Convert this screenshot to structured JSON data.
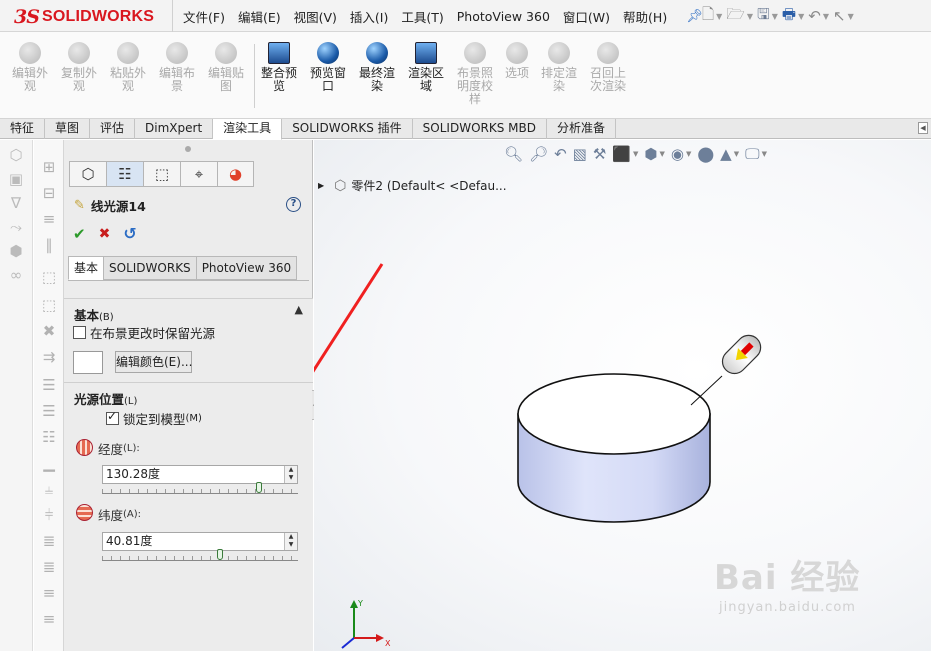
{
  "app": {
    "brand_ds": "3S",
    "brand_name": "SOLIDWORKS"
  },
  "menu": {
    "items": [
      "文件(F)",
      "编辑(E)",
      "视图(V)",
      "插入(I)",
      "工具(T)",
      "PhotoView 360",
      "窗口(W)",
      "帮助(H)"
    ]
  },
  "ribbon": {
    "buttons": [
      {
        "label1": "编辑外",
        "label2": "观"
      },
      {
        "label1": "复制外",
        "label2": "观"
      },
      {
        "label1": "粘贴外",
        "label2": "观"
      },
      {
        "label1": "编辑布",
        "label2": "景"
      },
      {
        "label1": "编辑贴",
        "label2": "图"
      },
      {
        "label1": "整合预",
        "label2": "览"
      },
      {
        "label1": "预览窗",
        "label2": "口"
      },
      {
        "label1": "最终渲",
        "label2": "染"
      },
      {
        "label1": "渲染区",
        "label2": "域"
      },
      {
        "label1": "布景照",
        "label2": "明度校",
        "label3": "样"
      },
      {
        "label1": "选项",
        "label2": ""
      },
      {
        "label1": "排定渲",
        "label2": "染"
      },
      {
        "label1": "召回上",
        "label2": "次渲染"
      }
    ]
  },
  "tabs": [
    "特征",
    "草图",
    "评估",
    "DimXpert",
    "渲染工具",
    "SOLIDWORKS 插件",
    "SOLIDWORKS MBD",
    "分析准备"
  ],
  "property_manager": {
    "title": "线光源14",
    "help": "?",
    "subtabs": [
      "基本",
      "SOLIDWORKS",
      "PhotoView 360"
    ],
    "basic_group": {
      "heading": "基本",
      "heading_key": "(B)",
      "keep_light_label": "在布景更改时保留光源",
      "keep_light_checked": false,
      "edit_color_label": "编辑颜色(E)..."
    },
    "position_group": {
      "heading": "光源位置",
      "heading_key": "(L)",
      "lock_label": "锁定到模型",
      "lock_key": "(M)",
      "lock_checked": true,
      "longitude_label": "经度",
      "longitude_key": "(L):",
      "longitude_value": "130.28度",
      "longitude_fraction": 0.8,
      "latitude_label": "纬度",
      "latitude_key": "(A):",
      "latitude_value": "40.81度",
      "latitude_fraction": 0.6
    }
  },
  "viewport": {
    "tree_label": "零件2  (Default< <Defau...",
    "watermark": "Bai 经验",
    "watermark_url": "jingyan.baidu.com",
    "triad_axes": {
      "x": "X",
      "y": "Y"
    }
  }
}
